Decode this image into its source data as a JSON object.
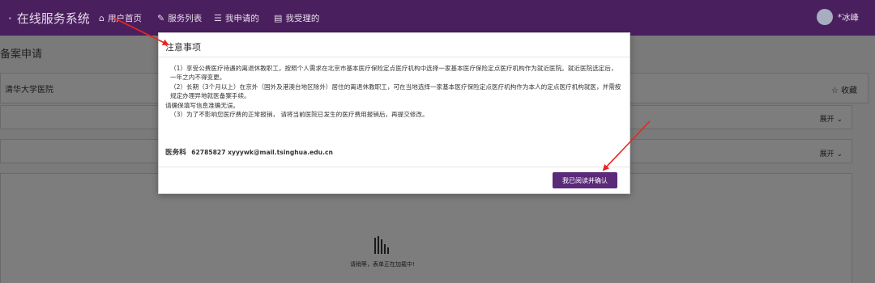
{
  "navbar": {
    "brand_dot": "·",
    "brand": "在线服务系统",
    "items": [
      {
        "icon": "home-icon",
        "glyph": "⌂",
        "label": "用户首页"
      },
      {
        "icon": "edit-icon",
        "glyph": "✎",
        "label": "服务列表"
      },
      {
        "icon": "list-icon",
        "glyph": "☰",
        "label": "我申请的"
      },
      {
        "icon": "table-icon",
        "glyph": "▤",
        "label": "我受理的"
      }
    ],
    "user": "*冰峰"
  },
  "page": {
    "title": "备案申请",
    "hospital": "清华大学医院",
    "favorite": "☆ 收藏",
    "expand_1": "展开 ⌄",
    "expand_2": "展开 ⌄",
    "loading_text": "请稍等，表单正在加载中!"
  },
  "modal": {
    "title": "注意事项",
    "notice": {
      "item_1": "（1）享受公费医疗待遇的离退休教职工，按照个人需求在北京市基本医疗保险定点医疗机构中选择一家基本医疗保险定点医疗机构作为就近医院。就近医院选定后，一年之内不得变更。",
      "item_2": "（2）长期（3个月以上）在京外（国外及港澳台地区除外）居住的离退休教职工，可在当地选择一家基本医疗保险定点医疗机构作为本人的定点医疗机构就医，并需按规定办理异地就医备案手续。",
      "reminder": "请确保填写信息准确无误。",
      "item_3": "（3）为了不影响您医疗费的正常报销， 请将当前医院已发生的医疗费用报销后，再提交修改。"
    },
    "contact_dept": "医务科",
    "contact_info": "62785827 xyyywk@mail.tsinghua.edu.cn",
    "confirm_label": "我已阅读并确认"
  },
  "colors": {
    "navbar": "#4a1f5e",
    "accent": "#5b2a78",
    "annotation": "#e8261f"
  }
}
